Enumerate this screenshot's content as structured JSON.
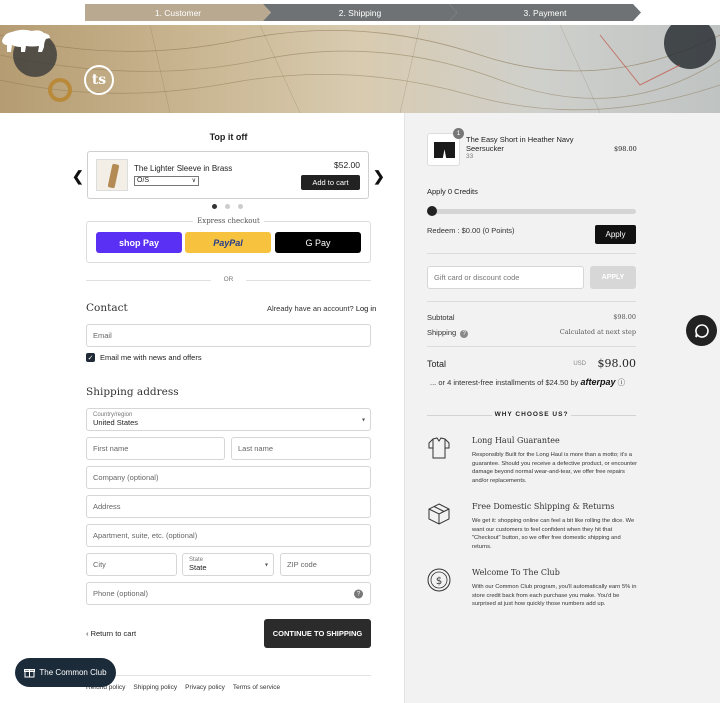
{
  "steps": [
    "1. Customer",
    "2. Shipping",
    "3. Payment"
  ],
  "upsell": {
    "heading": "Top it off",
    "name": "The Lighter Sleeve in Brass",
    "option": "O/S",
    "price": "$52.00",
    "add_label": "Add to cart"
  },
  "express": {
    "label": "Express checkout",
    "shop": "shop Pay",
    "paypal": "PayPal",
    "gpay": "G Pay"
  },
  "or_label": "OR",
  "contact": {
    "heading": "Contact",
    "have_account": "Already have an account?",
    "login": "Log in",
    "email_placeholder": "Email",
    "news_label": "Email me with news and offers"
  },
  "shipping": {
    "heading": "Shipping address",
    "country_label": "Country/region",
    "country_value": "United States",
    "first": "First name",
    "last": "Last name",
    "company": "Company (optional)",
    "address": "Address",
    "apartment": "Apartment, suite, etc. (optional)",
    "city": "City",
    "state_label": "State",
    "state_value": "State",
    "zip": "ZIP code",
    "phone": "Phone (optional)"
  },
  "nav": {
    "return": "Return to cart",
    "continue": "CONTINUE TO SHIPPING"
  },
  "footer": [
    "Refund policy",
    "Shipping policy",
    "Privacy policy",
    "Terms of service"
  ],
  "club_button": "The Common Club",
  "summary": {
    "product_name": "The Easy Short in Heather Navy Seersucker",
    "product_size": "33",
    "quantity": "1",
    "product_price": "$98.00",
    "credits": "Apply 0 Credits",
    "credits_level": 0,
    "redeem": "Redeem : $0.00 (0 Points)",
    "apply": "Apply",
    "gift_placeholder": "Gift card or discount code",
    "apply2": "APPLY",
    "subtotal_label": "Subtotal",
    "subtotal_value": "$98.00",
    "shipping_label": "Shipping",
    "shipping_value": "Calculated at next step",
    "total_label": "Total",
    "currency": "USD",
    "total_value": "$98.00",
    "afterpay_text": "... or 4 interest-free installments of $24.50 by",
    "afterpay_brand": "afterpay"
  },
  "why": {
    "heading": "WHY CHOOSE US?",
    "features": [
      {
        "title": "Long Haul Guarantee",
        "text": "Responsibly Built for the Long Haul is more than a motto; it's a guarantee. Should you receive a defective product, or encounter damage beyond normal wear-and-tear, we offer free repairs and/or replacements.",
        "icon": "shirt-icon"
      },
      {
        "title": "Free Domestic Shipping & Returns",
        "text": "We get it: shopping online can feel a bit like rolling the dice. We want our customers to feel confident when they hit that \"Checkout\" button, so we offer free domestic shipping and returns.",
        "icon": "box-icon"
      },
      {
        "title": "Welcome To The Club",
        "text": "With our Common Club program, you'll automatically earn 5% in store credit back from each purchase you make. You'd be surprised at just how quickly those numbers add up.",
        "icon": "coin-icon"
      }
    ]
  }
}
